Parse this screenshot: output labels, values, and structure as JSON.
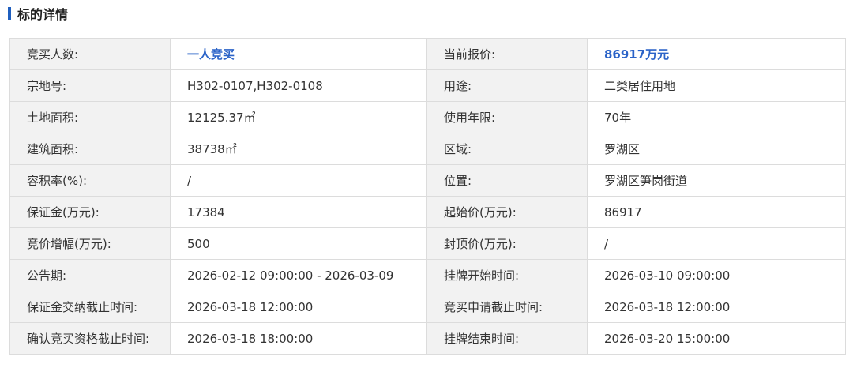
{
  "header": {
    "title": "标的详情",
    "accent_color": "#1f5fbf"
  },
  "colors": {
    "label_bg": "#f2f2f2",
    "border": "#dcdcdc",
    "highlight_text": "#2b63c8"
  },
  "rows": [
    {
      "l1": "竞买人数:",
      "v1": "一人竞买",
      "l2": "当前报价:",
      "v2": "86917万元"
    },
    {
      "l1": "宗地号:",
      "v1": "H302-0107,H302-0108",
      "l2": "用途:",
      "v2": "二类居住用地"
    },
    {
      "l1": "土地面积:",
      "v1": "12125.37㎡",
      "l2": "使用年限:",
      "v2": "70年"
    },
    {
      "l1": "建筑面积:",
      "v1": "38738㎡",
      "l2": "区域:",
      "v2": "罗湖区"
    },
    {
      "l1": "容积率(%):",
      "v1": "/",
      "l2": "位置:",
      "v2": "罗湖区笋岗街道"
    },
    {
      "l1": "保证金(万元):",
      "v1": "17384",
      "l2": "起始价(万元):",
      "v2": "86917"
    },
    {
      "l1": "竞价增幅(万元):",
      "v1": "500",
      "l2": "封顶价(万元):",
      "v2": "/"
    },
    {
      "l1": "公告期:",
      "v1": "2026-02-12 09:00:00 - 2026-03-09",
      "l2": "挂牌开始时间:",
      "v2": "2026-03-10 09:00:00"
    },
    {
      "l1": "保证金交纳截止时间:",
      "v1": "2026-03-18 12:00:00",
      "l2": "竞买申请截止时间:",
      "v2": "2026-03-18 12:00:00"
    },
    {
      "l1": "确认竞买资格截止时间:",
      "v1": "2026-03-18 18:00:00",
      "l2": "挂牌结束时间:",
      "v2": "2026-03-20 15:00:00"
    }
  ]
}
